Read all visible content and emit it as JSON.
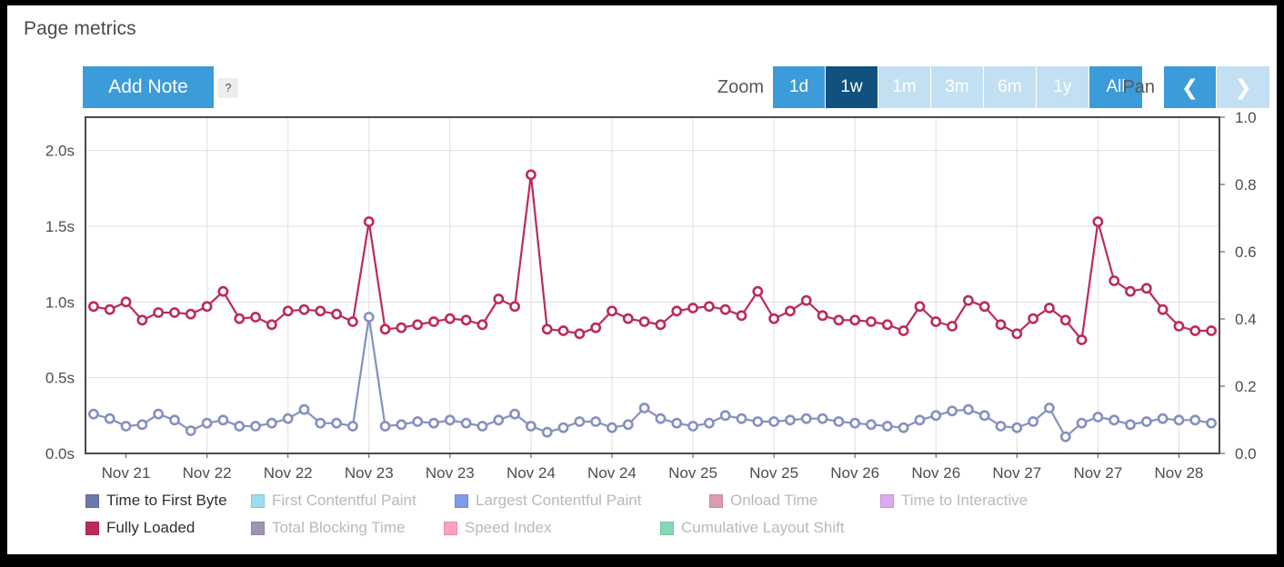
{
  "panel": {
    "title": "Page metrics"
  },
  "toolbar": {
    "add_note_label": "Add Note",
    "help_label": "?",
    "zoom_label": "Zoom",
    "pan_label": "Pan",
    "ranges": [
      {
        "label": "1d",
        "state": "mid"
      },
      {
        "label": "1w",
        "state": "active"
      },
      {
        "label": "1m",
        "state": "light"
      },
      {
        "label": "3m",
        "state": "light"
      },
      {
        "label": "6m",
        "state": "light"
      },
      {
        "label": "1y",
        "state": "light"
      },
      {
        "label": "All",
        "state": "mid"
      }
    ],
    "pan_prev_icon": "❮",
    "pan_next_icon": "❯"
  },
  "colors": {
    "accent_blue": "#3c9bd9",
    "accent_blue_light": "#c3e0f2",
    "accent_blue_dark": "#11517d",
    "fully_loaded": "#bb2a5d",
    "time_to_first_byte": "#8490c0",
    "grid": "#dedede",
    "axis": "#4a4a4a"
  },
  "legend": {
    "rows": [
      [
        {
          "label": "Time to First Byte",
          "color": "#6b78ad",
          "active": true
        },
        {
          "label": "First Contentful Paint",
          "color": "#9ddcf2",
          "active": false
        },
        {
          "label": "Largest Contentful Paint",
          "color": "#7f9ae8",
          "active": false
        },
        {
          "label": "Onload Time",
          "color": "#dd9bb2",
          "active": false
        },
        {
          "label": "Time to Interactive",
          "color": "#ddaaee",
          "active": false
        }
      ],
      [
        {
          "label": "Fully Loaded",
          "color": "#bb2a5d",
          "active": true
        },
        {
          "label": "Total Blocking Time",
          "color": "#a093b0",
          "active": false
        },
        {
          "label": "Speed Index",
          "color": "#ff9fc4",
          "active": false
        },
        {
          "label": "Cumulative Layout Shift",
          "color": "#86d9b6",
          "active": false
        }
      ]
    ]
  },
  "chart_data": {
    "type": "line",
    "title": "Page metrics",
    "xlabel": "",
    "ylabel": "",
    "grid": true,
    "legend_position": "bottom",
    "left_axis": {
      "label": "",
      "ticks": [
        "0.0s",
        "0.5s",
        "1.0s",
        "1.5s",
        "2.0s"
      ],
      "tick_values": [
        0.0,
        0.5,
        1.0,
        1.5,
        2.0
      ],
      "ylim": [
        0.0,
        2.22
      ]
    },
    "right_axis": {
      "label": "",
      "ticks": [
        "0.0",
        "0.2",
        "0.4",
        "0.6",
        "0.8",
        "1.0"
      ],
      "tick_values": [
        0.0,
        0.2,
        0.4,
        0.6,
        0.8,
        1.0
      ],
      "ylim": [
        0.0,
        1.0
      ]
    },
    "x_tick_labels": [
      "Nov 21",
      "Nov 22",
      "Nov 22",
      "Nov 23",
      "Nov 23",
      "Nov 24",
      "Nov 24",
      "Nov 25",
      "Nov 25",
      "Nov 26",
      "Nov 26",
      "Nov 27",
      "Nov 27",
      "Nov 28"
    ],
    "n_points": 70,
    "series": [
      {
        "name": "Fully Loaded",
        "color": "#bb2a5d",
        "axis": "left",
        "values": [
          0.97,
          0.95,
          1.0,
          0.88,
          0.93,
          0.93,
          0.92,
          0.97,
          1.07,
          0.89,
          0.9,
          0.85,
          0.94,
          0.95,
          0.94,
          0.92,
          0.87,
          1.53,
          0.82,
          0.83,
          0.85,
          0.87,
          0.89,
          0.88,
          0.85,
          1.02,
          0.97,
          1.84,
          0.82,
          0.81,
          0.79,
          0.83,
          0.94,
          0.89,
          0.87,
          0.85,
          0.94,
          0.96,
          0.97,
          0.95,
          0.91,
          1.07,
          0.89,
          0.94,
          1.01,
          0.91,
          0.88,
          0.88,
          0.87,
          0.85,
          0.81,
          0.97,
          0.87,
          0.84,
          1.01,
          0.97,
          0.85,
          0.79,
          0.89,
          0.96,
          0.88,
          0.75,
          1.53,
          1.14,
          1.07,
          1.09,
          0.95,
          0.84,
          0.81,
          0.81
        ]
      },
      {
        "name": "Time to First Byte",
        "color": "#8490c0",
        "axis": "left",
        "values": [
          0.26,
          0.23,
          0.18,
          0.19,
          0.26,
          0.22,
          0.15,
          0.2,
          0.22,
          0.18,
          0.18,
          0.2,
          0.23,
          0.29,
          0.2,
          0.2,
          0.18,
          0.9,
          0.18,
          0.19,
          0.21,
          0.2,
          0.22,
          0.2,
          0.18,
          0.22,
          0.26,
          0.18,
          0.14,
          0.17,
          0.21,
          0.21,
          0.17,
          0.19,
          0.3,
          0.23,
          0.2,
          0.18,
          0.2,
          0.25,
          0.23,
          0.21,
          0.21,
          0.22,
          0.23,
          0.23,
          0.21,
          0.2,
          0.19,
          0.18,
          0.17,
          0.22,
          0.25,
          0.28,
          0.29,
          0.25,
          0.18,
          0.17,
          0.21,
          0.3,
          0.11,
          0.2,
          0.24,
          0.22,
          0.19,
          0.21,
          0.23,
          0.22,
          0.22,
          0.2
        ]
      }
    ]
  }
}
